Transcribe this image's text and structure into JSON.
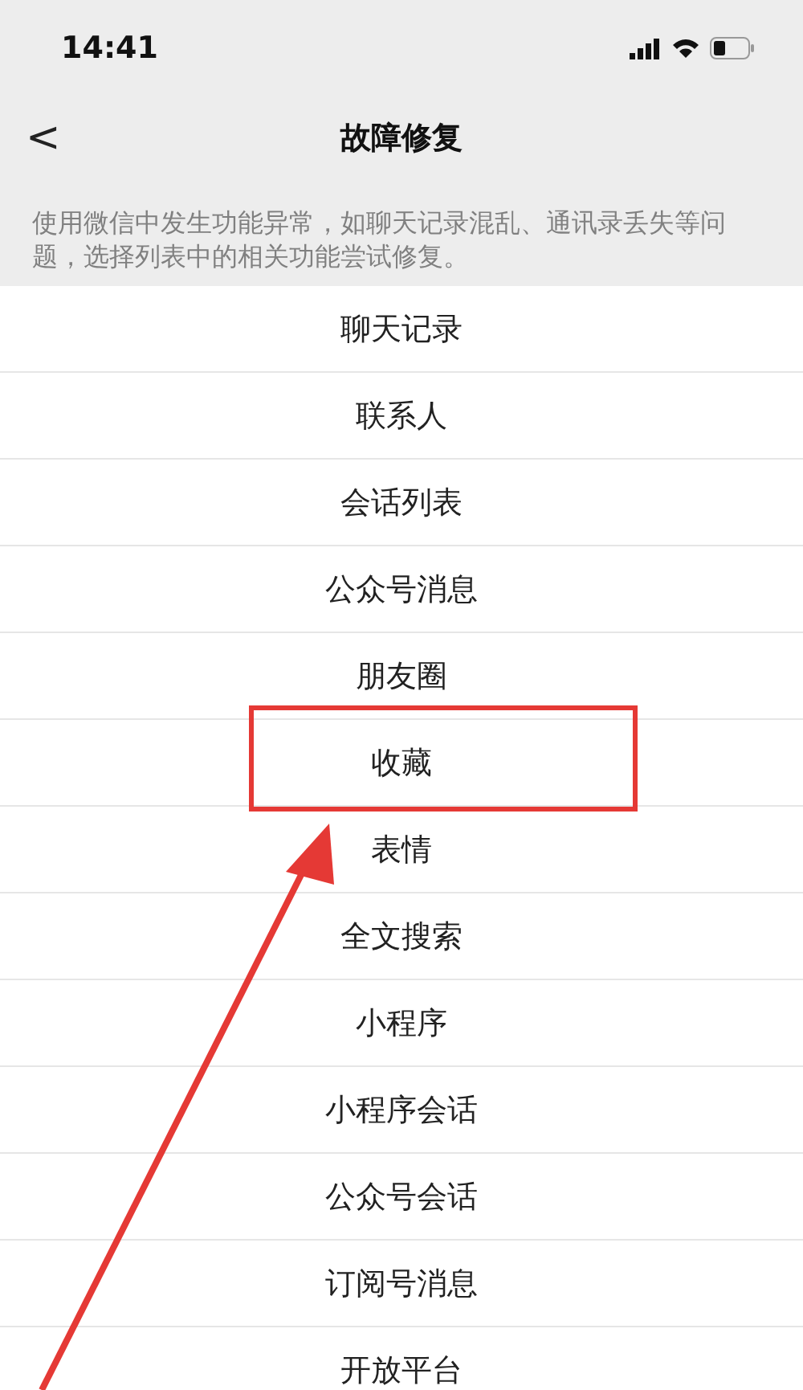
{
  "status_bar": {
    "time": "14:41"
  },
  "nav": {
    "back": "<",
    "title": "故障修复"
  },
  "description": "使用微信中发生功能异常，如聊天记录混乱、通讯录丢失等问题，选择列表中的相关功能尝试修复。",
  "items": [
    {
      "label": "聊天记录",
      "highlighted": false
    },
    {
      "label": "联系人",
      "highlighted": false
    },
    {
      "label": "会话列表",
      "highlighted": false
    },
    {
      "label": "公众号消息",
      "highlighted": false
    },
    {
      "label": "朋友圈",
      "highlighted": false
    },
    {
      "label": "收藏",
      "highlighted": true
    },
    {
      "label": "表情",
      "highlighted": false
    },
    {
      "label": "全文搜索",
      "highlighted": false
    },
    {
      "label": "小程序",
      "highlighted": false
    },
    {
      "label": "小程序会话",
      "highlighted": false
    },
    {
      "label": "公众号会话",
      "highlighted": false
    },
    {
      "label": "订阅号消息",
      "highlighted": false
    },
    {
      "label": "开放平台",
      "highlighted": false
    }
  ]
}
